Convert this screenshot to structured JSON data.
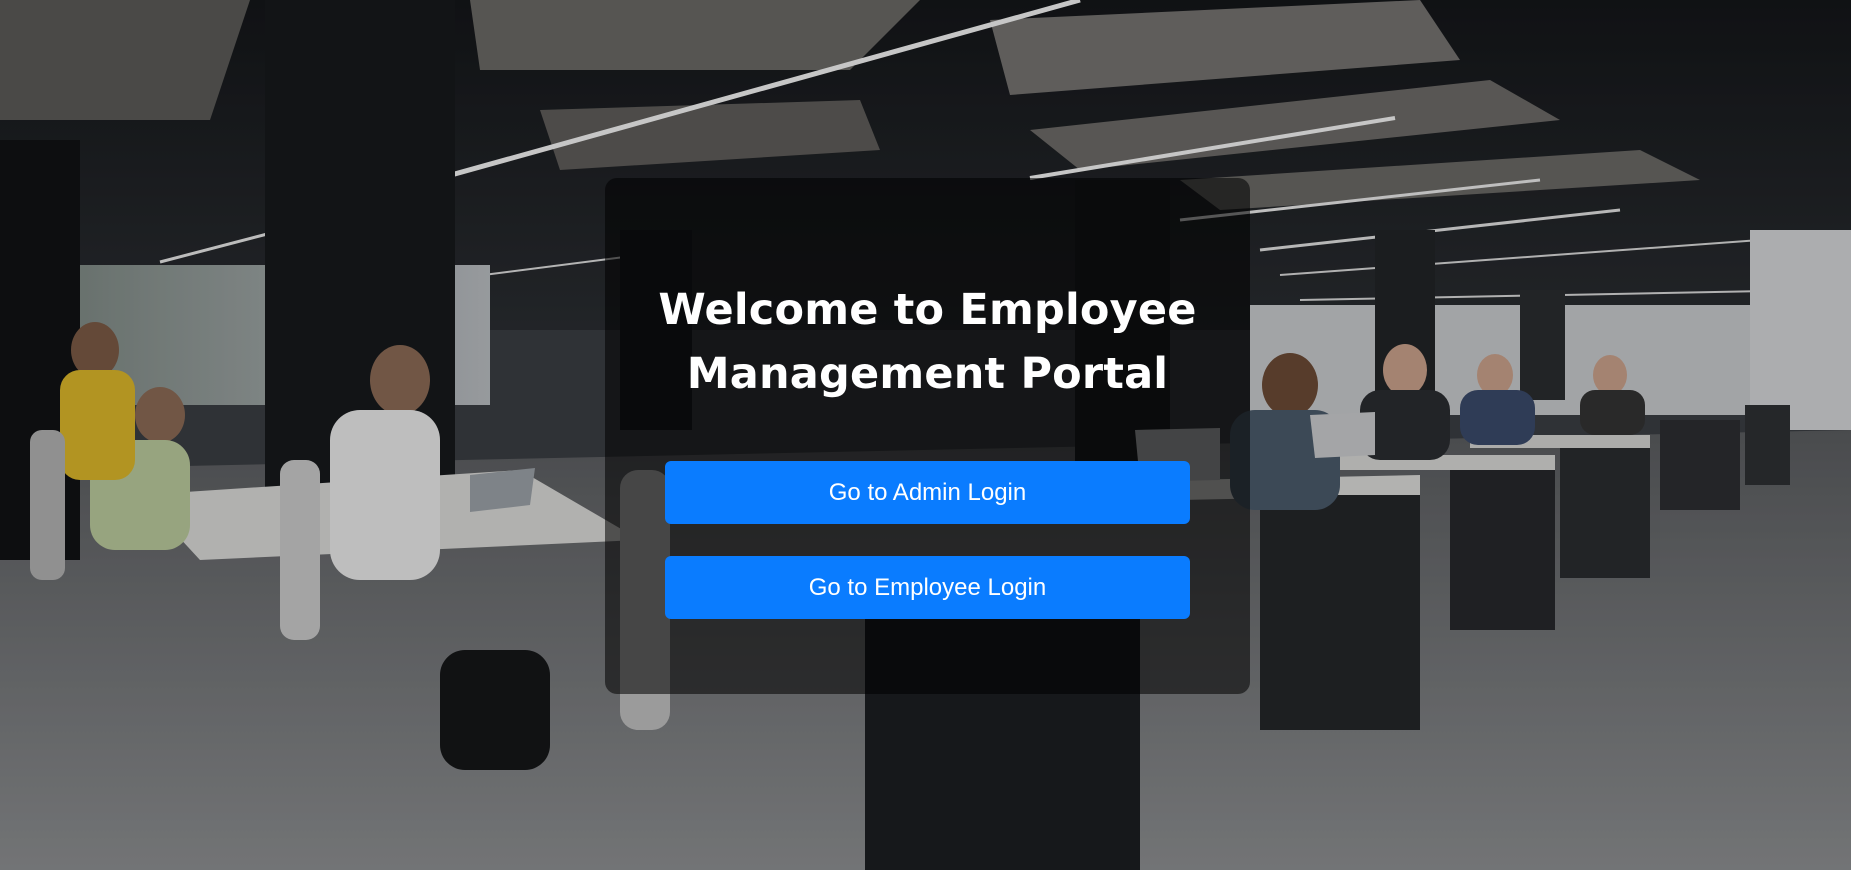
{
  "portal": {
    "title": "Welcome to Employee Management Portal",
    "buttons": {
      "admin_login": "Go to Admin Login",
      "employee_login": "Go to Employee Login"
    }
  },
  "colors": {
    "button_bg": "#0a7cff",
    "button_text": "#ffffff",
    "title_text": "#ffffff",
    "overlay": "rgba(0,0,0,0.55)"
  },
  "background": {
    "description_icon": "office-workspace-photo"
  }
}
